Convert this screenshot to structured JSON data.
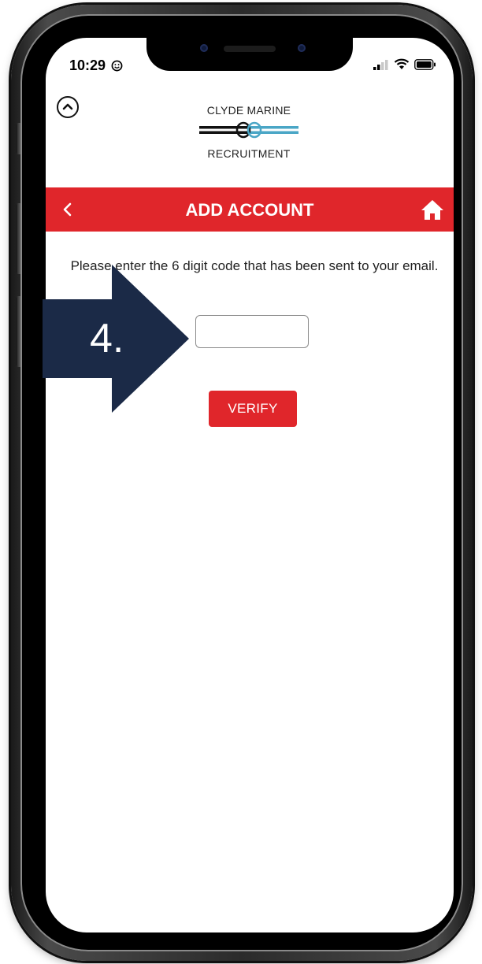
{
  "status_bar": {
    "time": "10:29",
    "icons": [
      "smiley-icon",
      "signal-icon",
      "wifi-icon",
      "battery-icon"
    ]
  },
  "logo": {
    "line1": "CLYDE MARINE",
    "line2": "RECRUITMENT"
  },
  "header": {
    "title": "ADD ACCOUNT",
    "back_icon": "chevron-left-icon",
    "home_icon": "home-icon"
  },
  "form": {
    "instructions": "Please enter the 6 digit code that has been sent to your email.",
    "code_value": "",
    "verify_label": "VERIFY"
  },
  "annotation": {
    "step_label": "4."
  },
  "colors": {
    "accent": "#e0262b",
    "arrow": "#1b2a47",
    "rope_blue": "#4aa6c6"
  }
}
